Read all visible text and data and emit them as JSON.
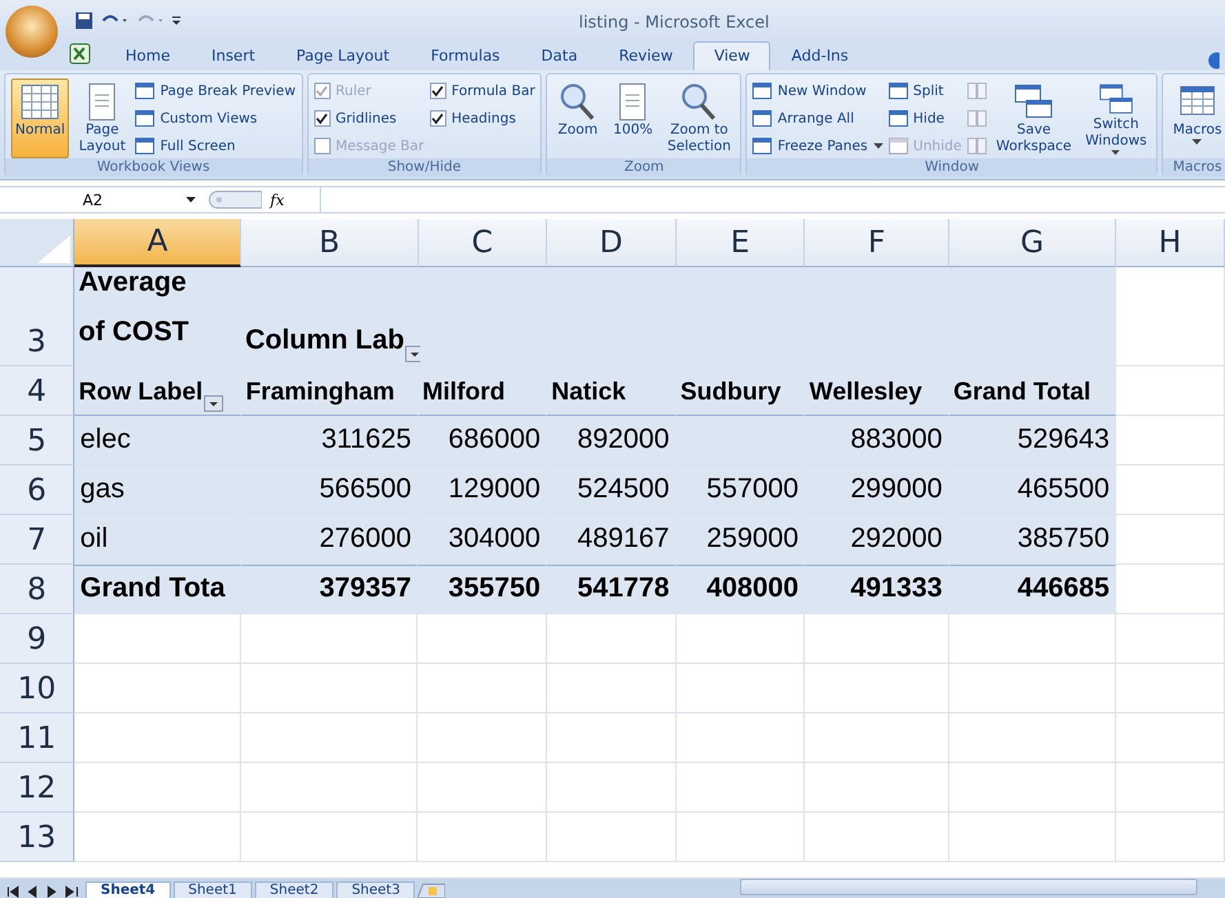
{
  "window": {
    "title": "listing - Microsoft Excel"
  },
  "tabs": [
    {
      "label": "Home",
      "selected": false
    },
    {
      "label": "Insert",
      "selected": false
    },
    {
      "label": "Page Layout",
      "selected": false
    },
    {
      "label": "Formulas",
      "selected": false
    },
    {
      "label": "Data",
      "selected": false
    },
    {
      "label": "Review",
      "selected": false
    },
    {
      "label": "View",
      "selected": true
    },
    {
      "label": "Add-Ins",
      "selected": false
    }
  ],
  "ribbon_groups": [
    {
      "name": "Workbook Views",
      "columns": [
        [
          {
            "kind": "large",
            "label": "Normal",
            "selected": true
          }
        ],
        [
          {
            "kind": "large",
            "label": "Page Layout",
            "selected": false
          }
        ],
        [
          {
            "kind": "small",
            "label": "Page Break Preview",
            "disabled": false,
            "dropdown": false
          },
          {
            "kind": "small",
            "label": "Custom Views",
            "disabled": false,
            "dropdown": false
          },
          {
            "kind": "small",
            "label": "Full Screen",
            "disabled": false,
            "dropdown": false
          }
        ]
      ]
    },
    {
      "name": "Show/Hide",
      "columns": [
        [
          {
            "kind": "check",
            "label": "Ruler",
            "checked": true,
            "disabled": true
          },
          {
            "kind": "check",
            "label": "Gridlines",
            "checked": true,
            "disabled": false
          },
          {
            "kind": "check",
            "label": "Message Bar",
            "checked": false,
            "disabled": true
          }
        ],
        [
          {
            "kind": "check",
            "label": "Formula Bar",
            "checked": true,
            "disabled": false
          },
          {
            "kind": "check",
            "label": "Headings",
            "checked": true,
            "disabled": false
          }
        ]
      ]
    },
    {
      "name": "Zoom",
      "columns": [
        [
          {
            "kind": "large",
            "label": "Zoom",
            "selected": false
          }
        ],
        [
          {
            "kind": "large",
            "label": "100%",
            "selected": false
          }
        ],
        [
          {
            "kind": "large",
            "label": "Zoom to Selection",
            "selected": false
          }
        ]
      ]
    },
    {
      "name": "Window",
      "columns": [
        [
          {
            "kind": "small",
            "label": "New Window",
            "disabled": false,
            "dropdown": false
          },
          {
            "kind": "small",
            "label": "Arrange All",
            "disabled": false,
            "dropdown": false
          },
          {
            "kind": "small",
            "label": "Freeze Panes",
            "disabled": false,
            "dropdown": true
          }
        ],
        [
          {
            "kind": "small",
            "label": "Split",
            "disabled": false,
            "dropdown": false
          },
          {
            "kind": "small",
            "label": "Hide",
            "disabled": false,
            "dropdown": false
          },
          {
            "kind": "small",
            "label": "Unhide",
            "disabled": true,
            "dropdown": false
          }
        ],
        [
          {
            "kind": "icon",
            "disabled": true
          },
          {
            "kind": "icon",
            "disabled": true
          },
          {
            "kind": "icon",
            "disabled": true
          }
        ],
        [
          {
            "kind": "large",
            "label": "Save Workspace",
            "selected": false
          }
        ],
        [
          {
            "kind": "large",
            "label": "Switch Windows",
            "selected": false,
            "dropdown": true
          }
        ]
      ]
    },
    {
      "name": "Macros",
      "columns": [
        [
          {
            "kind": "large",
            "label": "Macros",
            "selected": false,
            "dropdown": true
          }
        ]
      ]
    }
  ],
  "formula_bar": {
    "name_box": "A2",
    "function_label": "fx"
  },
  "columns": [
    {
      "label": "A",
      "selected": true
    },
    {
      "label": "B",
      "selected": false
    },
    {
      "label": "C",
      "selected": false
    },
    {
      "label": "D",
      "selected": false
    },
    {
      "label": "E",
      "selected": false
    },
    {
      "label": "F",
      "selected": false
    },
    {
      "label": "G",
      "selected": false
    },
    {
      "label": "H",
      "selected": false
    }
  ],
  "rows": [
    {
      "number": "3",
      "kind": "caption",
      "cells": [
        "Average of COST",
        {
          "text": "Column Lab",
          "filter": true
        }
      ]
    },
    {
      "number": "4",
      "kind": "header",
      "cells": [
        {
          "text": "Row Label",
          "filter": true
        },
        "Framingham",
        "Milford",
        "Natick",
        "Sudbury",
        "Wellesley",
        "Grand Total"
      ]
    },
    {
      "number": "5",
      "kind": "data",
      "cells": [
        "elec",
        "311625",
        "686000",
        "892000",
        null,
        "883000",
        "529643"
      ]
    },
    {
      "number": "6",
      "kind": "data",
      "cells": [
        "gas",
        "566500",
        "129000",
        "524500",
        "557000",
        "299000",
        "465500"
      ]
    },
    {
      "number": "7",
      "kind": "data",
      "cells": [
        "oil",
        "276000",
        "304000",
        "489167",
        "259000",
        "292000",
        "385750"
      ]
    },
    {
      "number": "8",
      "kind": "total",
      "cells": [
        "Grand Tota",
        "379357",
        "355750",
        "541778",
        "408000",
        "491333",
        "446685"
      ]
    },
    {
      "number": "9",
      "kind": "empty",
      "cells": []
    },
    {
      "number": "10",
      "kind": "empty",
      "cells": []
    },
    {
      "number": "11",
      "kind": "empty",
      "cells": []
    },
    {
      "number": "12",
      "kind": "empty",
      "cells": []
    },
    {
      "number": "13",
      "kind": "empty",
      "cells": []
    }
  ],
  "sheet_tabs": [
    {
      "label": "Sheet4",
      "selected": true
    },
    {
      "label": "Sheet1",
      "selected": false
    },
    {
      "label": "Sheet2",
      "selected": false
    },
    {
      "label": "Sheet3",
      "selected": false
    }
  ]
}
